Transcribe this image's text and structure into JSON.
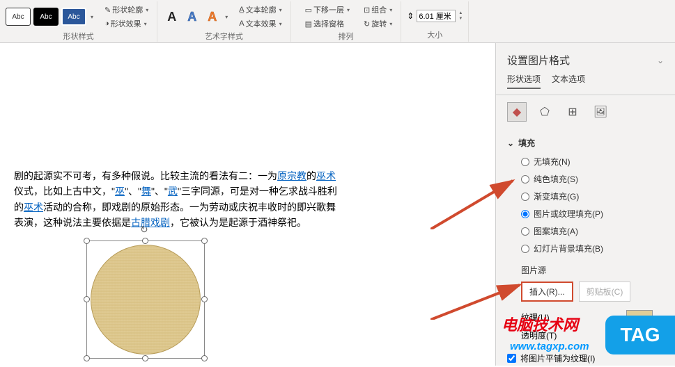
{
  "ribbon": {
    "shape_styles": {
      "label": "Abc"
    },
    "shape_style_group": "形状样式",
    "shape_outline": "形状轮廓",
    "shape_effects": "形状效果",
    "text_style_group": "艺术字样式",
    "text_outline": "文本轮廓",
    "text_effects": "文本效果",
    "arrange_group": "排列",
    "send_backward": "下移一层",
    "selection_pane": "选择窗格",
    "group": "组合",
    "rotate": "旋转",
    "size_group": "大小",
    "size_value": "6.01 厘米"
  },
  "document": {
    "text_p1_a": "剧的起源实不可考，有多种假说。比较主流的看法有二：一为",
    "link1": "原宗教",
    "text_p1_b": "的",
    "link2": "巫术",
    "text_p1_c": "仪式，比如上古中文，\"",
    "link3": "巫",
    "text_p1_d": "\"、\"",
    "link4": "舞",
    "text_p1_e": "\"、\"",
    "link5": "武",
    "text_p1_f": "\"三字同源，可是对一种乞求战斗胜利的",
    "link6": "巫术",
    "text_p1_g": "活动的合称，即戏剧的原始形态。一为劳动或庆祝丰收时的即兴歌舞表演，这种说法主要依据是",
    "link7": "古腊戏剧",
    "text_p1_h": "，它被认为是起源于酒神祭祀。"
  },
  "panel": {
    "title": "设置图片格式",
    "tab_shape": "形状选项",
    "tab_text": "文本选项",
    "fill_section": "填充",
    "fill_none": "无填充(N)",
    "fill_solid": "纯色填充(S)",
    "fill_gradient": "渐变填充(G)",
    "fill_picture": "图片或纹理填充(P)",
    "fill_pattern": "图案填充(A)",
    "fill_slide": "幻灯片背景填充(B)",
    "pic_source": "图片源",
    "insert_btn": "插入(R)...",
    "clipboard_btn": "剪贴板(C)",
    "texture_label": "纹理(U)",
    "transparency_label": "透明度(T)",
    "tile_label": "将图片平铺为纹理(I)"
  },
  "watermark": {
    "line1": "电脑技术网",
    "line2": "www.tagxp.com",
    "tag": "TAG"
  }
}
